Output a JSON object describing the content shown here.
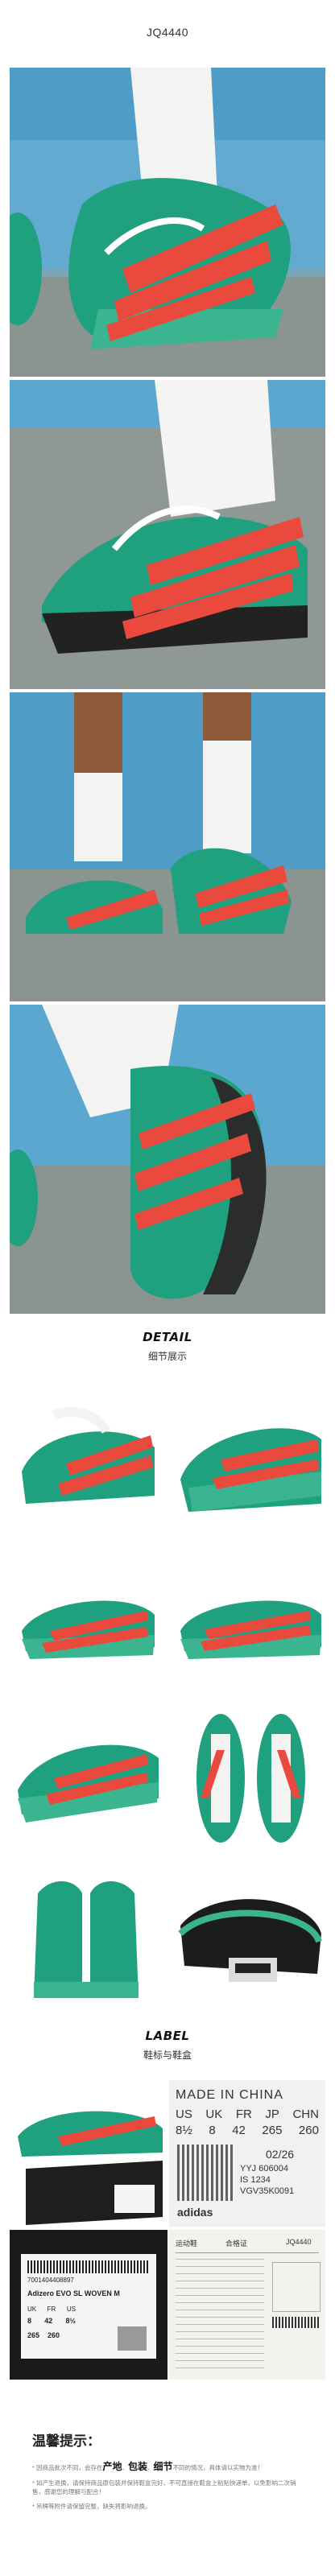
{
  "product_code": "JQ4440",
  "detail_section": {
    "title_en": "DETAIL",
    "title_cn": "细节展示"
  },
  "label_section": {
    "title_en": "LABEL",
    "title_cn": "鞋标与鞋盒"
  },
  "shoe_label": {
    "made_in": "MADE IN CHINA",
    "size_headers": [
      "US",
      "UK",
      "FR",
      "JP",
      "CHN"
    ],
    "size_values": [
      "8½",
      "8",
      "42",
      "265",
      "260"
    ],
    "date": "02/26",
    "codes": [
      "YYJ 606004",
      "IS 1234",
      "VGV35K0091"
    ],
    "brand": "adidas"
  },
  "box_label": {
    "barcode_number": "7001404408897",
    "model": "Adizero EVO SL WOVEN M",
    "size_headers": [
      "UK",
      "FR",
      "US"
    ],
    "size_values": [
      "8",
      "42",
      "8½"
    ],
    "jp_cn": [
      "265",
      "260"
    ]
  },
  "cert": {
    "left_title": "运动鞋",
    "center_title": "合格证",
    "code": "JQ4440"
  },
  "tips": {
    "title": "温馨提示：",
    "line1_prefix": "* 因商品批次不同，会存在",
    "kw1": "产地",
    "kw_sep1": "、",
    "kw2": "包装",
    "kw_sep2": "、",
    "kw3": "细节",
    "line1_suffix": "不同的情况，具体请以实物为准！",
    "line2": "* 如产生退换，请保持商品原包装并保持鞋盒完好、不可直接在鞋盒上粘贴快递单，以免影响二次销售，感谢您的理解与配合！",
    "line3": "* 吊牌等附件请保留完整，缺失将影响退换。"
  },
  "colors": {
    "upper_green": "#1fa07f",
    "stripe_red": "#ea4a3d",
    "sole_green": "#4fae86",
    "sky_blue": "#4f9dc7"
  }
}
